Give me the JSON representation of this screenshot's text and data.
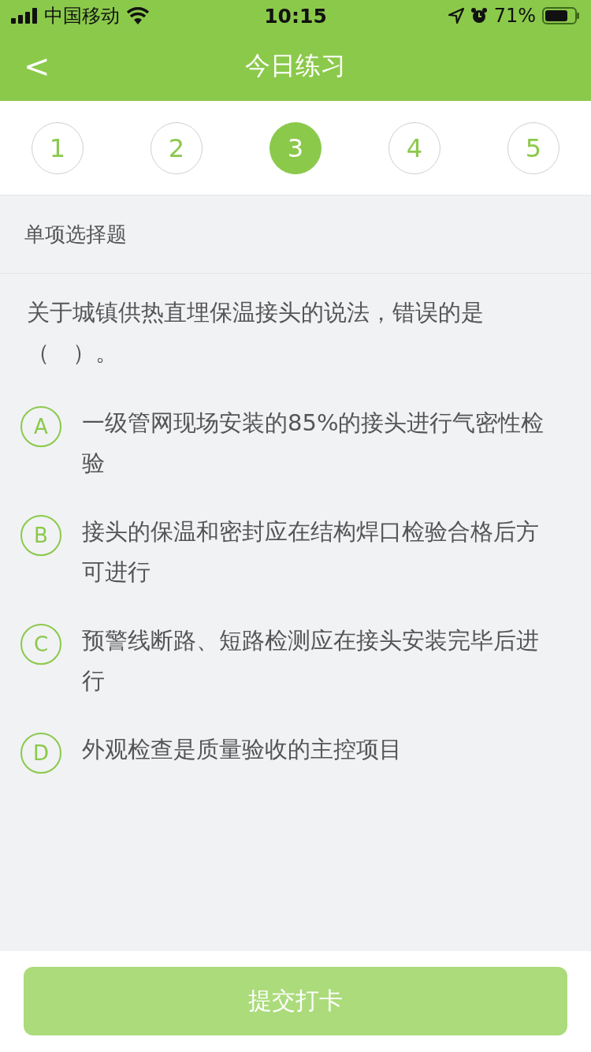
{
  "status_bar": {
    "carrier": "中国移动",
    "time": "10:15",
    "battery": "71%"
  },
  "nav": {
    "back": "<",
    "title": "今日练习"
  },
  "steps": [
    {
      "label": "1",
      "selected": false
    },
    {
      "label": "2",
      "selected": false
    },
    {
      "label": "3",
      "selected": true
    },
    {
      "label": "4",
      "selected": false
    },
    {
      "label": "5",
      "selected": false
    }
  ],
  "section": {
    "title": "单项选择题"
  },
  "question": {
    "text": "关于城镇供热直埋保温接头的说法，错误的是（　）。",
    "options": [
      {
        "letter": "A",
        "text": "一级管网现场安装的85%的接头进行气密性检验",
        "selected": false
      },
      {
        "letter": "B",
        "text": "接头的保温和密封应在结构焊口检验合格后方可进行",
        "selected": false
      },
      {
        "letter": "C",
        "text": "预警线断路、短路检测应在接头安装完毕后进行",
        "selected": false
      },
      {
        "letter": "D",
        "text": "外观检查是质量验收的主控项目",
        "selected": false
      }
    ]
  },
  "submit": {
    "label": "提交打卡",
    "disabled": true
  }
}
